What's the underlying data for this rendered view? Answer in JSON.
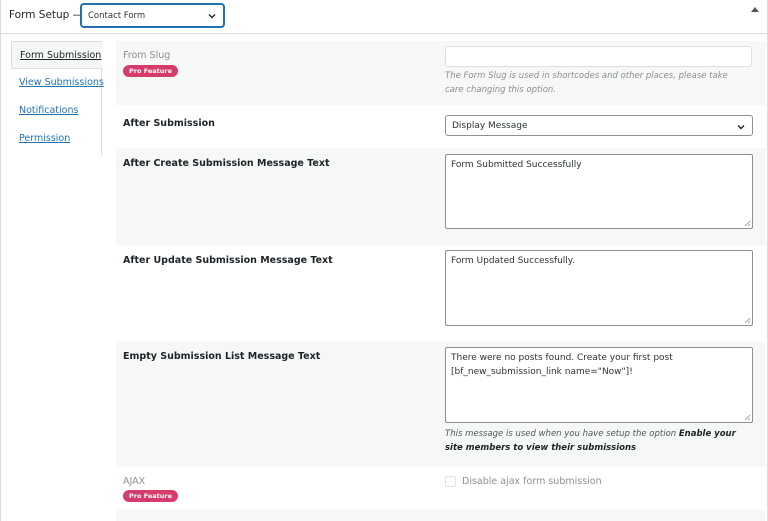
{
  "header": {
    "title": "Form Setup —",
    "form_select_value": "Contact Form"
  },
  "tabs": [
    {
      "label": "Form Submission",
      "active": true
    },
    {
      "label": "View Submissions",
      "active": false
    },
    {
      "label": "Notifications",
      "active": false
    },
    {
      "label": "Permission",
      "active": false
    }
  ],
  "fields": {
    "form_slug": {
      "label": "From Slug",
      "badge": "Pro Feature",
      "value": "",
      "help": "The Form Slug is used in shortcodes and other places, please take care changing this option."
    },
    "after_submission": {
      "label": "After Submission",
      "value": "Display Message"
    },
    "after_create_message": {
      "label": "After Create Submission Message Text",
      "value": "Form Submitted Successfully"
    },
    "after_update_message": {
      "label": "After Update Submission Message Text",
      "value": "Form Updated Successfully."
    },
    "empty_list_message": {
      "label": "Empty Submission List Message Text",
      "value_line1": "There were no posts found. Create your first post",
      "value_line2": "[bf_new_submission_link name=\"Now\"]!",
      "help_prefix": "This message is used when you have setup the option",
      "help_bold": "Enable your site members to view their submissions"
    },
    "ajax": {
      "label": "AJAX",
      "badge": "Pro Feature",
      "checkbox_label": "Disable ajax form submission",
      "checked": false
    }
  },
  "colors": {
    "accent": "#2271b1",
    "pro_badge": "#d63c6b",
    "alt_row": "#f6f7f7"
  }
}
